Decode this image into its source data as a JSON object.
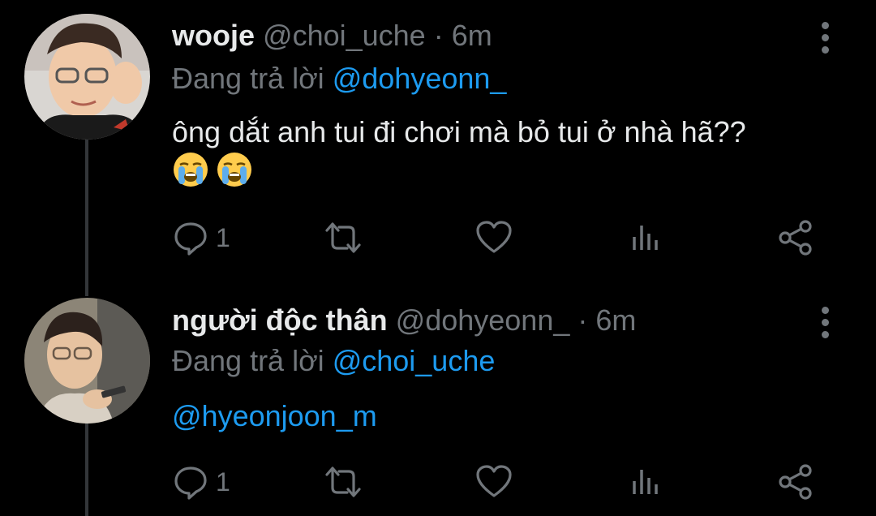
{
  "tweets": [
    {
      "display_name": "wooje",
      "handle": "@choi_uche",
      "separator": "·",
      "time": "6m",
      "reply_prefix": "Đang trả lời",
      "reply_to": "@dohyeonn_",
      "text": "ông dắt anh tui đi chơi mà bỏ tui ở nhà hã??",
      "emojis": [
        "loudly-crying-face",
        "loudly-crying-face"
      ],
      "reply_count": "1"
    },
    {
      "display_name": "người độc thân",
      "handle": "@dohyeonn_",
      "separator": "·",
      "time": "6m",
      "reply_prefix": "Đang trả lời",
      "reply_to": "@choi_uche",
      "text": "@hyeonjoon_m",
      "reply_count": "1"
    }
  ],
  "icons": {
    "reply": "reply-icon",
    "retweet": "retweet-icon",
    "like": "heart-icon",
    "analytics": "analytics-icon",
    "share": "share-icon",
    "more": "more-vertical-icon"
  },
  "colors": {
    "background": "#000000",
    "text": "#e7e9ea",
    "muted": "#71767b",
    "link": "#1d9bf0",
    "thread_line": "#333639"
  }
}
